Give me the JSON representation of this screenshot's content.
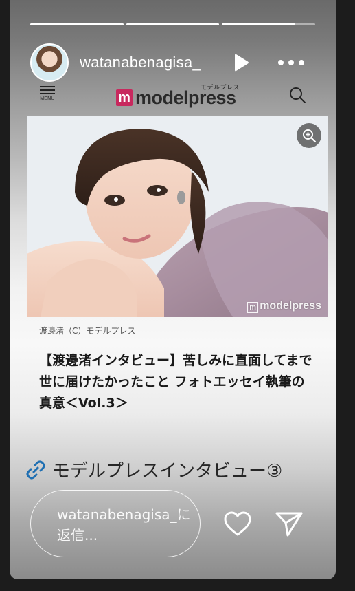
{
  "story": {
    "progress": [
      1.0,
      1.0,
      0.78
    ],
    "username": "watanabenagisa_"
  },
  "site": {
    "menu_label": "MENU",
    "logo_kana": "モデルプレス",
    "logo_mark": "m",
    "logo_text": "modelpress"
  },
  "article": {
    "watermark_mark": "m",
    "watermark_text": "modelpress",
    "caption": "渡邊渚（C）モデルプレス",
    "headline": "【渡邊渚インタビュー】苦しみに直面してまで世に届けたかったこと フォトエッセイ執筆の真意＜Vol.3＞"
  },
  "link_sticker": {
    "label": "モデルプレスインタビュー③",
    "icon": "link-icon"
  },
  "reply": {
    "placeholder": "watanabenagisa_に返信..."
  },
  "icons": {
    "play": "play-icon",
    "more": "more-icon",
    "menu": "menu-icon",
    "search": "search-icon",
    "zoom": "zoom-in-icon",
    "heart": "heart-icon",
    "send": "send-icon"
  },
  "colors": {
    "brand_accent": "#c8295e",
    "link_blue": "#1f6fb2"
  }
}
